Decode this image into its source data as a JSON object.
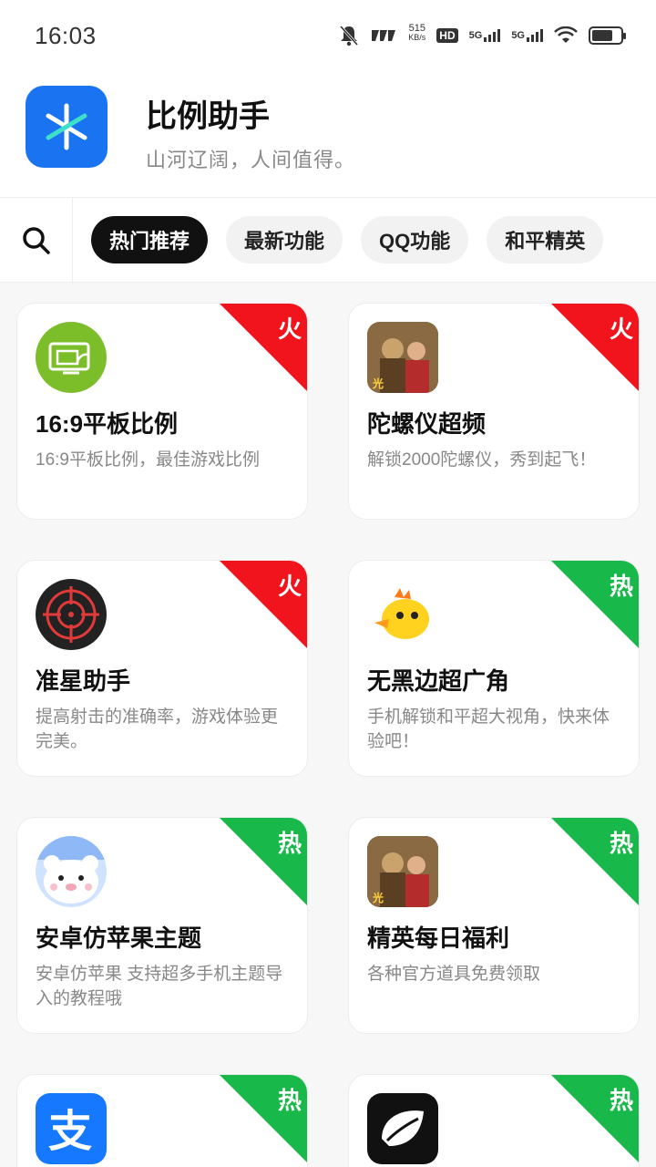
{
  "status_bar": {
    "time": "16:03",
    "net_speed_value": "515",
    "net_speed_unit": "KB/s",
    "hd": "HD",
    "signal_1": "5G",
    "signal_2": "5G"
  },
  "app": {
    "name": "比例助手",
    "slogan": "山河辽阔，人间值得。",
    "logo_color": "#1a74f2"
  },
  "tabs": [
    {
      "label": "热门推荐",
      "active": true
    },
    {
      "label": "最新功能",
      "active": false
    },
    {
      "label": "QQ功能",
      "active": false
    },
    {
      "label": "和平精英",
      "active": false
    }
  ],
  "badge_colors": {
    "fire": "#f2141d",
    "hot": "#19b84a"
  },
  "cards": [
    {
      "title": "16:9平板比例",
      "desc": "16:9平板比例，最佳游戏比例",
      "badge": "火",
      "icon": "green-tablet-icon"
    },
    {
      "title": "陀螺仪超频",
      "desc": "解锁2000陀螺仪，秀到起飞！",
      "badge": "火",
      "icon": "game-characters-icon"
    },
    {
      "title": "准星助手",
      "desc": "提高射击的准确率，游戏体验更完美。",
      "badge": "火",
      "icon": "crosshair-icon"
    },
    {
      "title": "无黑边超广角",
      "desc": "手机解锁和平超大视角，快来体验吧！",
      "badge": "热",
      "icon": "yellow-chick-icon"
    },
    {
      "title": "安卓仿苹果主题",
      "desc": "安卓仿苹果 支持超多手机主题导入的教程哦",
      "badge": "热",
      "icon": "white-bear-icon"
    },
    {
      "title": "精英每日福利",
      "desc": "各种官方道具免费领取",
      "badge": "热",
      "icon": "game-characters-icon"
    },
    {
      "title": "",
      "desc": "",
      "badge": "热",
      "icon": "alipay-icon"
    },
    {
      "title": "",
      "desc": "",
      "badge": "热",
      "icon": "black-leaf-icon"
    }
  ]
}
